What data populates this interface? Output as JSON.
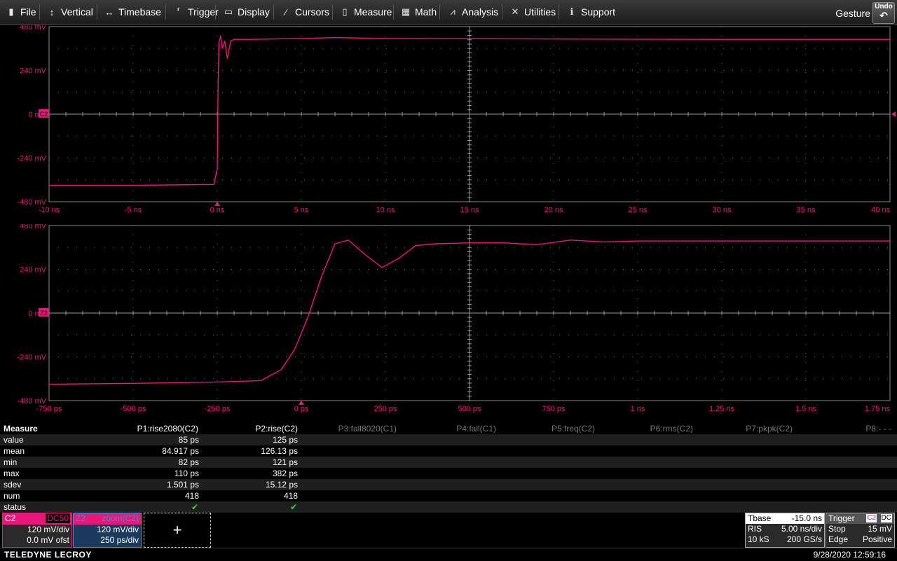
{
  "menu": {
    "items": [
      {
        "label": "File",
        "icon": "file-icon"
      },
      {
        "label": "Vertical",
        "icon": "vertical-icon"
      },
      {
        "label": "Timebase",
        "icon": "timebase-icon"
      },
      {
        "label": "Trigger",
        "icon": "trigger-icon"
      },
      {
        "label": "Display",
        "icon": "display-icon"
      },
      {
        "label": "Cursors",
        "icon": "cursors-icon"
      },
      {
        "label": "Measure",
        "icon": "measure-icon"
      },
      {
        "label": "Math",
        "icon": "math-icon"
      },
      {
        "label": "Analysis",
        "icon": "analysis-icon"
      },
      {
        "label": "Utilities",
        "icon": "utilities-icon"
      },
      {
        "label": "Support",
        "icon": "support-icon"
      }
    ],
    "gesture": "Gesture",
    "undo": "Undo"
  },
  "colors": {
    "trace": "#e8177a",
    "grid": "#6e6e6e",
    "check": "#33dd33",
    "z2": "#3a8fd8"
  },
  "chart_data": [
    {
      "type": "line",
      "channel_tag": "C2",
      "x_unit": "ns",
      "xlim": [
        -10,
        40
      ],
      "ylim": [
        -480,
        480
      ],
      "y_unit": "mV",
      "xticks": [
        "-10 ns",
        "-5 ns",
        "0 ns",
        "5 ns",
        "10 ns",
        "15 ns",
        "20 ns",
        "25 ns",
        "30 ns",
        "35 ns",
        "40 ns"
      ],
      "yticks": [
        "480 mV",
        "240 mV",
        "0 mV",
        "-240 mV",
        "-480 mV"
      ],
      "series": [
        {
          "x": [
            -10,
            -5,
            -0.2,
            0,
            0.05,
            0.1,
            0.2,
            0.3,
            0.45,
            0.6,
            0.8,
            1,
            2,
            5,
            7,
            10,
            20,
            30,
            40
          ],
          "y": [
            -390,
            -390,
            -385,
            -300,
            150,
            390,
            430,
            360,
            400,
            305,
            400,
            410,
            410,
            415,
            420,
            415,
            412,
            410,
            410
          ]
        }
      ]
    },
    {
      "type": "line",
      "channel_tag": "Z2",
      "x_unit": "ps",
      "xlim": [
        -750,
        1750
      ],
      "ylim": [
        -480,
        480
      ],
      "y_unit": "mV",
      "xticks": [
        "-750 ps",
        "-500 ps",
        "-250 ps",
        "0 ps",
        "250 ps",
        "500 ps",
        "750 ps",
        "1 ns",
        "1.25 ns",
        "1.5 ns",
        "1.75 ns"
      ],
      "yticks": [
        "480 mV",
        "240 mV",
        "0 mV",
        "-240 mV",
        "-480 mV"
      ],
      "series": [
        {
          "x": [
            -750,
            -500,
            -250,
            -120,
            -60,
            -20,
            20,
            60,
            100,
            140,
            190,
            240,
            290,
            340,
            400,
            500,
            600,
            700,
            800,
            900,
            1000,
            1250,
            1500,
            1750
          ],
          "y": [
            -390,
            -385,
            -378,
            -370,
            -310,
            -200,
            -20,
            200,
            380,
            400,
            320,
            250,
            300,
            370,
            380,
            385,
            385,
            375,
            400,
            390,
            395,
            395,
            395,
            395
          ]
        }
      ]
    }
  ],
  "measure": {
    "header": "Measure",
    "params": [
      {
        "label": "P1:rise2080(C2)",
        "active": true
      },
      {
        "label": "P2:rise(C2)",
        "active": true
      },
      {
        "label": "P3:fall8020(C1)",
        "active": false
      },
      {
        "label": "P4:fall(C1)",
        "active": false
      },
      {
        "label": "P5:freq(C2)",
        "active": false
      },
      {
        "label": "P6:rms(C2)",
        "active": false
      },
      {
        "label": "P7:pkpk(C2)",
        "active": false
      },
      {
        "label": "P8:- - -",
        "active": false
      }
    ],
    "rows": [
      {
        "name": "value",
        "p1": "85 ps",
        "p2": "125 ps"
      },
      {
        "name": "mean",
        "p1": "84.917 ps",
        "p2": "126.13 ps"
      },
      {
        "name": "min",
        "p1": "82 ps",
        "p2": "121 ps"
      },
      {
        "name": "max",
        "p1": "110 ps",
        "p2": "382 ps"
      },
      {
        "name": "sdev",
        "p1": "1.501 ps",
        "p2": "15.12 ps"
      },
      {
        "name": "num",
        "p1": "418",
        "p2": "418"
      },
      {
        "name": "status",
        "p1": "✔",
        "p2": "✔"
      }
    ]
  },
  "descriptors": {
    "c2": {
      "name": "C2",
      "coupling": "DC50",
      "vdiv": "120 mV/div",
      "offset": "0.0 mV ofst"
    },
    "z2": {
      "name": "Z2",
      "source": "zoom(C2)",
      "vdiv": "120 mV/div",
      "tdiv": "250 ps/div"
    },
    "add": "+"
  },
  "timebase": {
    "label": "Tbase",
    "delay": "-15.0 ns",
    "mode": "RIS",
    "tdiv": "5.00 ns/div",
    "samples": "10 kS",
    "rate": "200 GS/s"
  },
  "trigger": {
    "label": "Trigger",
    "src": "C2",
    "coupling": "DC",
    "state": "Stop",
    "level": "15 mV",
    "type": "Edge",
    "slope": "Positive"
  },
  "footer": {
    "brand": "TELEDYNE LECROY",
    "datetime": "9/28/2020 12:59:16"
  }
}
